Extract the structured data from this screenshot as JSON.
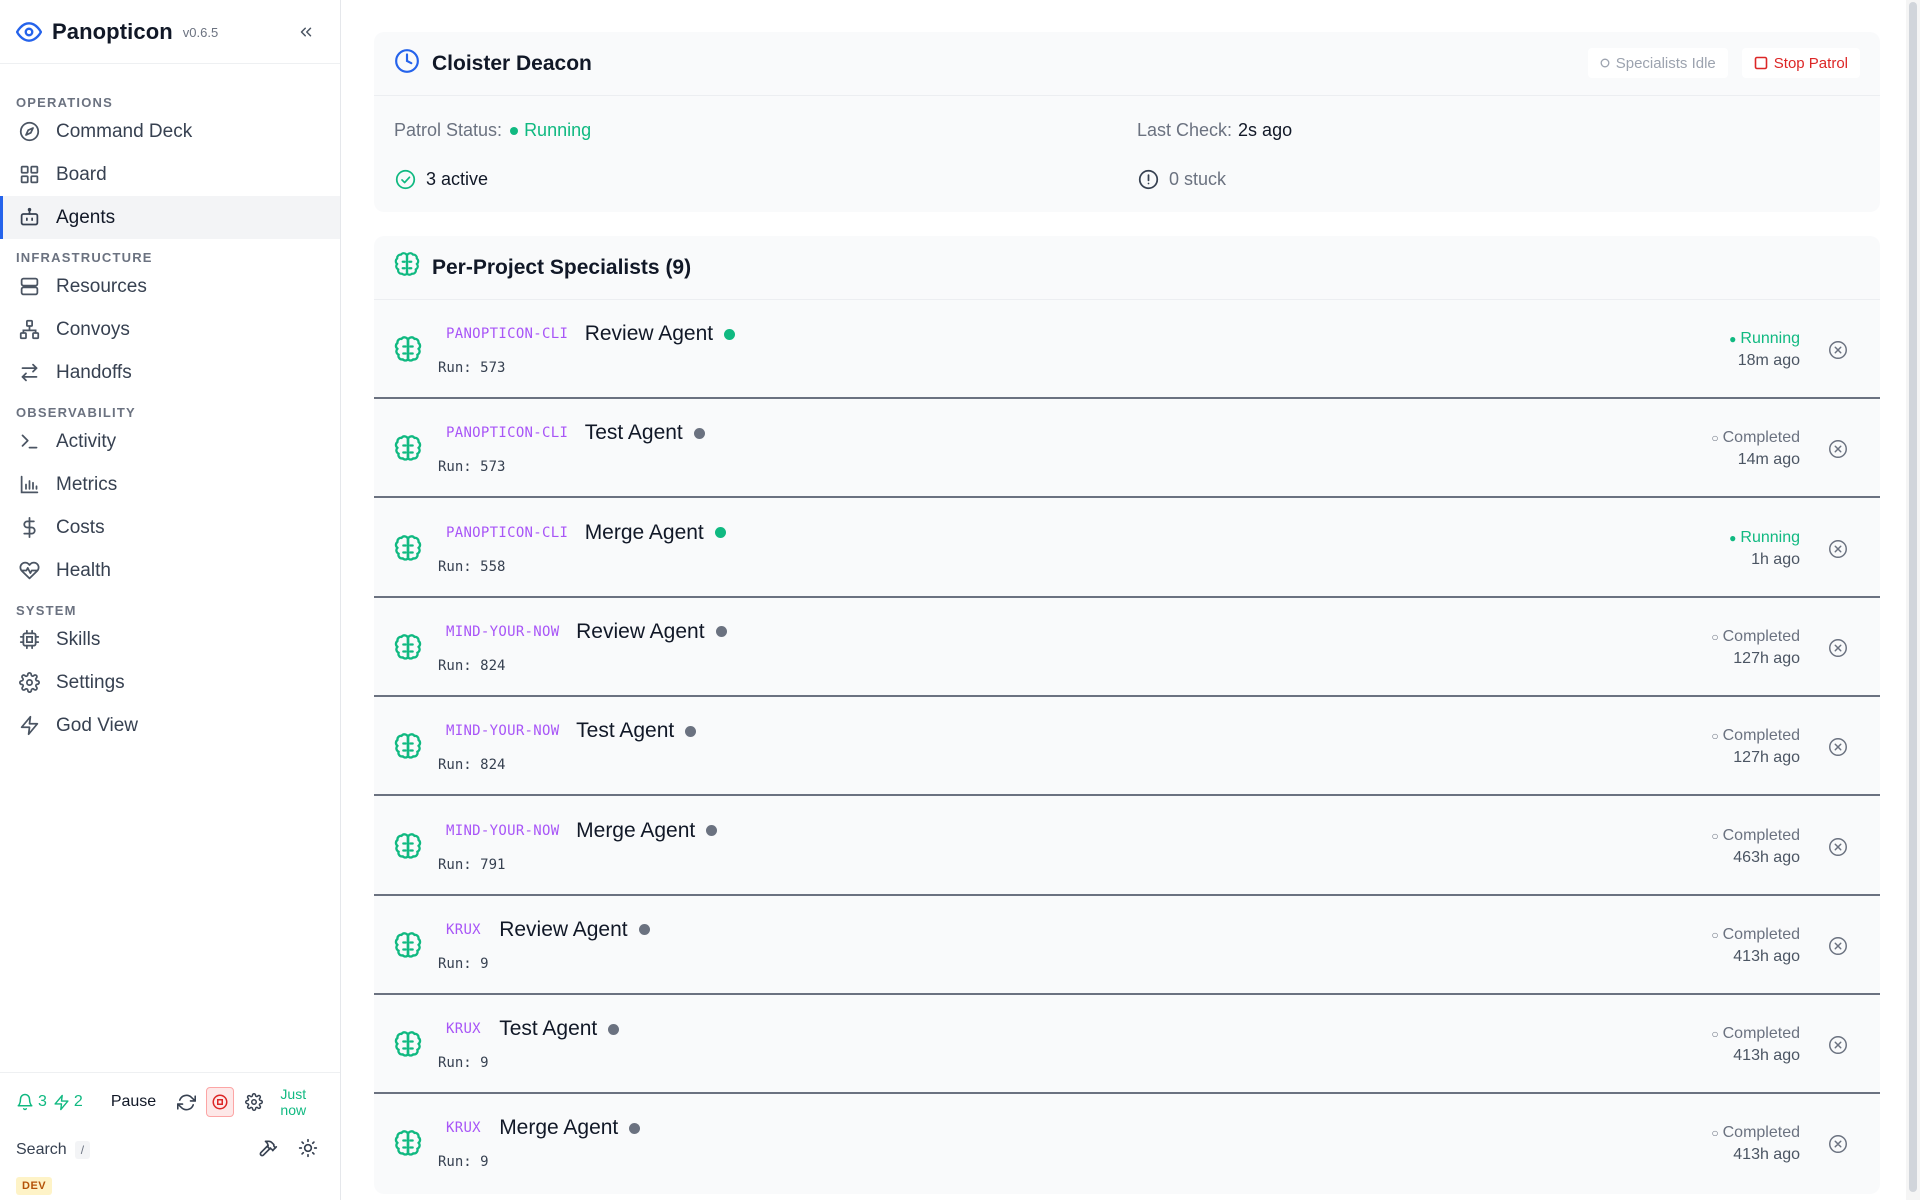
{
  "app": {
    "name": "Panopticon",
    "version": "v0.6.5"
  },
  "sidebar": {
    "sections": [
      {
        "label": "OPERATIONS",
        "items": [
          {
            "label": "Command Deck",
            "icon": "compass-icon"
          },
          {
            "label": "Board",
            "icon": "grid-icon"
          },
          {
            "label": "Agents",
            "icon": "bot-icon",
            "active": true
          }
        ]
      },
      {
        "label": "INFRASTRUCTURE",
        "items": [
          {
            "label": "Resources",
            "icon": "server-icon"
          },
          {
            "label": "Convoys",
            "icon": "network-icon"
          },
          {
            "label": "Handoffs",
            "icon": "arrows-icon"
          }
        ]
      },
      {
        "label": "OBSERVABILITY",
        "items": [
          {
            "label": "Activity",
            "icon": "terminal-icon"
          },
          {
            "label": "Metrics",
            "icon": "bar-chart-icon"
          },
          {
            "label": "Costs",
            "icon": "dollar-icon"
          },
          {
            "label": "Health",
            "icon": "heart-pulse-icon"
          }
        ]
      },
      {
        "label": "SYSTEM",
        "items": [
          {
            "label": "Skills",
            "icon": "chip-icon"
          },
          {
            "label": "Settings",
            "icon": "gear-icon"
          },
          {
            "label": "God View",
            "icon": "bolt-icon"
          }
        ]
      }
    ],
    "footer": {
      "notifications": "3",
      "alerts": "2",
      "pause_label": "Pause",
      "updated": "Just now",
      "search_label": "Search",
      "search_shortcut": "/",
      "env_badge": "DEV"
    }
  },
  "deacon": {
    "title": "Cloister Deacon",
    "specialists_idle_label": "Specialists Idle",
    "stop_patrol_label": "Stop Patrol",
    "patrol_status_key": "Patrol Status:",
    "patrol_status_value": "Running",
    "last_check_key": "Last Check:",
    "last_check_value": "2s ago",
    "active_label": "3 active",
    "stuck_label": "0 stuck"
  },
  "specialists": {
    "title": "Per-Project Specialists (9)",
    "rows": [
      {
        "project": "PANOPTICON-CLI",
        "agent": "Review Agent",
        "run": "Run: 573",
        "status": "Running",
        "ago": "18m ago"
      },
      {
        "project": "PANOPTICON-CLI",
        "agent": "Test Agent",
        "run": "Run: 573",
        "status": "Completed",
        "ago": "14m ago"
      },
      {
        "project": "PANOPTICON-CLI",
        "agent": "Merge Agent",
        "run": "Run: 558",
        "status": "Running",
        "ago": "1h ago"
      },
      {
        "project": "MIND-YOUR-NOW",
        "agent": "Review Agent",
        "run": "Run: 824",
        "status": "Completed",
        "ago": "127h ago"
      },
      {
        "project": "MIND-YOUR-NOW",
        "agent": "Test Agent",
        "run": "Run: 824",
        "status": "Completed",
        "ago": "127h ago"
      },
      {
        "project": "MIND-YOUR-NOW",
        "agent": "Merge Agent",
        "run": "Run: 791",
        "status": "Completed",
        "ago": "463h ago"
      },
      {
        "project": "KRUX",
        "agent": "Review Agent",
        "run": "Run: 9",
        "status": "Completed",
        "ago": "413h ago"
      },
      {
        "project": "KRUX",
        "agent": "Test Agent",
        "run": "Run: 9",
        "status": "Completed",
        "ago": "413h ago"
      },
      {
        "project": "KRUX",
        "agent": "Merge Agent",
        "run": "Run: 9",
        "status": "Completed",
        "ago": "413h ago"
      }
    ]
  },
  "colors": {
    "accent": "#2563eb",
    "running": "#10b981",
    "completed": "#6b7280",
    "project": "#a855f7",
    "danger": "#dc2626",
    "brain": "#10b981"
  }
}
